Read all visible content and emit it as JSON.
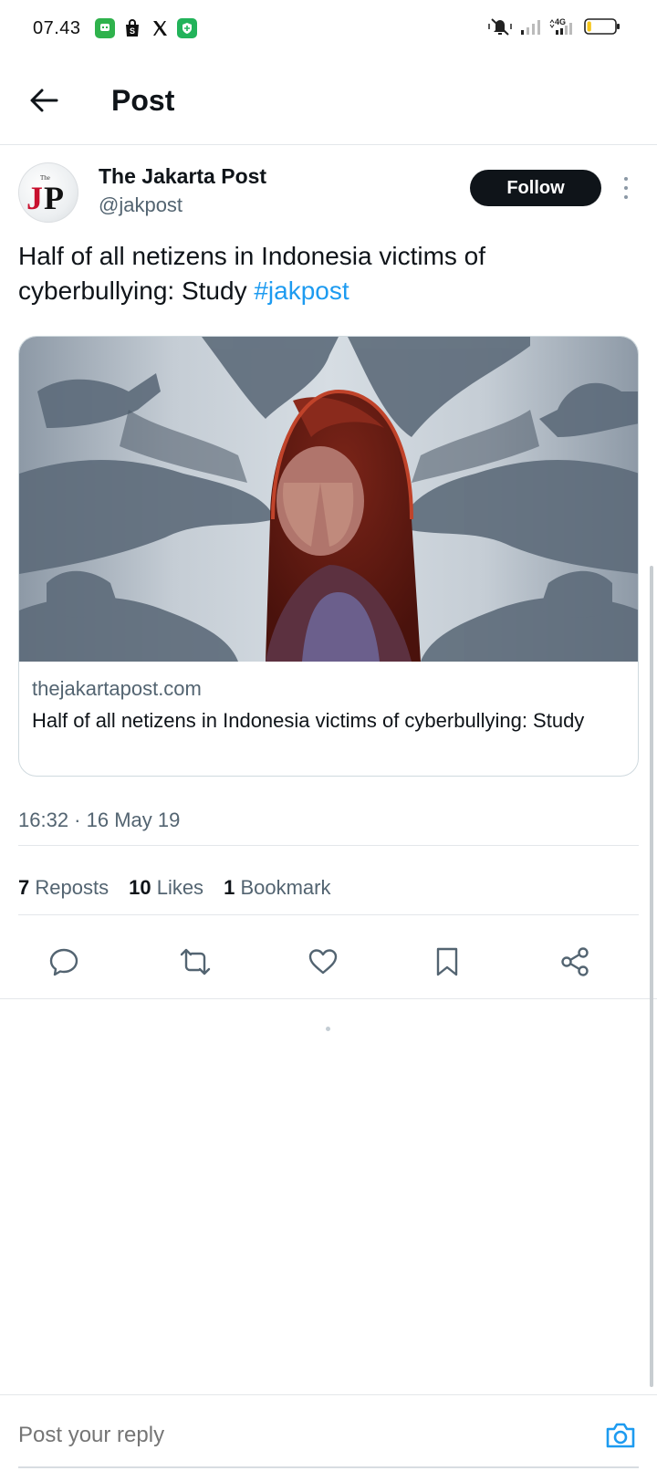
{
  "status_bar": {
    "time": "07.43",
    "apps": [
      "chat-app-icon",
      "shop-bag-icon",
      "x-logo-icon",
      "shield-app-icon"
    ],
    "network": "4G",
    "battery_level": 0.15
  },
  "header": {
    "title": "Post"
  },
  "post": {
    "author_name": "The Jakarta Post",
    "author_handle": "@jakpost",
    "avatar_logo": "JP",
    "follow_label": "Follow",
    "text": "Half of all netizens in Indonesia victims of cyberbullying: Study ",
    "hashtag": "#jakpost",
    "card": {
      "domain": "thejakartapost.com",
      "title": "Half of all netizens in Indonesia victims of cyberbullying: Study"
    },
    "timestamp": "16:32 · 16 May 19",
    "stats": [
      {
        "count": "7",
        "label": "Reposts"
      },
      {
        "count": "10",
        "label": "Likes"
      },
      {
        "count": "1",
        "label": "Bookmark"
      }
    ],
    "actions": [
      "reply",
      "repost",
      "like",
      "bookmark",
      "share"
    ]
  },
  "reply": {
    "placeholder": "Post your reply"
  },
  "colors": {
    "text": "#0f1419",
    "secondary": "#536471",
    "link": "#1d9bf0",
    "border": "#e4e7ea"
  }
}
